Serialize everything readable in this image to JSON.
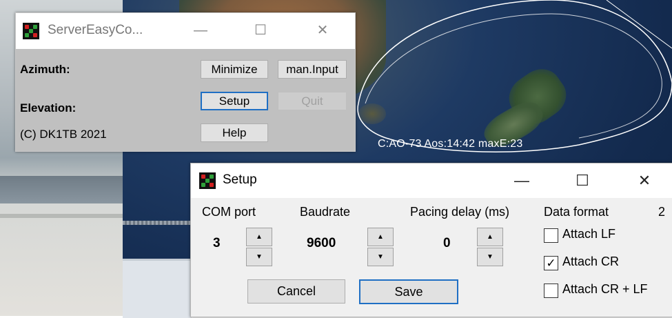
{
  "satellite": {
    "label": "C:AO-73 Aos:14:42 maxE:23"
  },
  "main_window": {
    "title": "ServerEasyCo...",
    "azimuth_label": "Azimuth:",
    "elevation_label": "Elevation:",
    "copyright": "(C) DK1TB 2021",
    "buttons": {
      "minimize": "Minimize",
      "man_input": "man.Input",
      "setup": "Setup",
      "quit": "Quit",
      "help": "Help"
    },
    "window_controls": {
      "minimize": "—",
      "maximize": "☐",
      "close": "✕"
    }
  },
  "setup_window": {
    "title": "Setup",
    "window_controls": {
      "minimize": "—",
      "maximize": "☐",
      "close": "✕"
    },
    "com_port": {
      "label": "COM port",
      "value": "3"
    },
    "baudrate": {
      "label": "Baudrate",
      "value": "9600"
    },
    "pacing_delay": {
      "label": "Pacing delay (ms)",
      "value": "0"
    },
    "data_format": {
      "label": "Data format",
      "extra": "2",
      "options": [
        {
          "label": "Attach LF",
          "checked": false
        },
        {
          "label": "Attach CR",
          "checked": true
        },
        {
          "label": "Attach CR + LF",
          "checked": false
        }
      ]
    },
    "spin_up": "▲",
    "spin_down": "▼",
    "check_mark": "✓",
    "buttons": {
      "cancel": "Cancel",
      "save": "Save"
    }
  },
  "colors": {
    "focus_border": "#1f6fc4",
    "map_ocean": "#132a4e",
    "orbit": "#ffffff"
  }
}
